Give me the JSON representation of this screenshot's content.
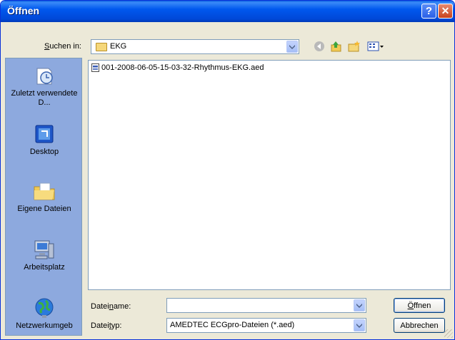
{
  "window": {
    "title": "Öffnen",
    "help": "?",
    "close": "✕"
  },
  "lookin": {
    "label_pre": "",
    "label_u": "S",
    "label_post": "uchen in:",
    "value": "EKG"
  },
  "places": [
    {
      "label": "Zuletzt verwendete D...",
      "icon": "recent-icon"
    },
    {
      "label": "Desktop",
      "icon": "desktop-icon"
    },
    {
      "label": "Eigene Dateien",
      "icon": "my-documents-icon"
    },
    {
      "label": "Arbeitsplatz",
      "icon": "my-computer-icon"
    },
    {
      "label": "Netzwerkumgeb",
      "icon": "network-icon"
    }
  ],
  "files": [
    {
      "name": "001-2008-06-05-15-03-32-Rhythmus-EKG.aed"
    }
  ],
  "filename": {
    "label_pre": "Datei",
    "label_u": "n",
    "label_post": "ame:",
    "value": ""
  },
  "filetype": {
    "label_pre": "Datei",
    "label_u": "t",
    "label_post": "yp:",
    "value": "AMEDTEC ECGpro-Dateien (*.aed)"
  },
  "buttons": {
    "open_u": "Ö",
    "open_rest": "ffnen",
    "cancel": "Abbrechen"
  },
  "colors": {
    "titlebar": "#0058EE",
    "places_bg": "#8DA9DE",
    "dialog_bg": "#ECE9D8"
  }
}
